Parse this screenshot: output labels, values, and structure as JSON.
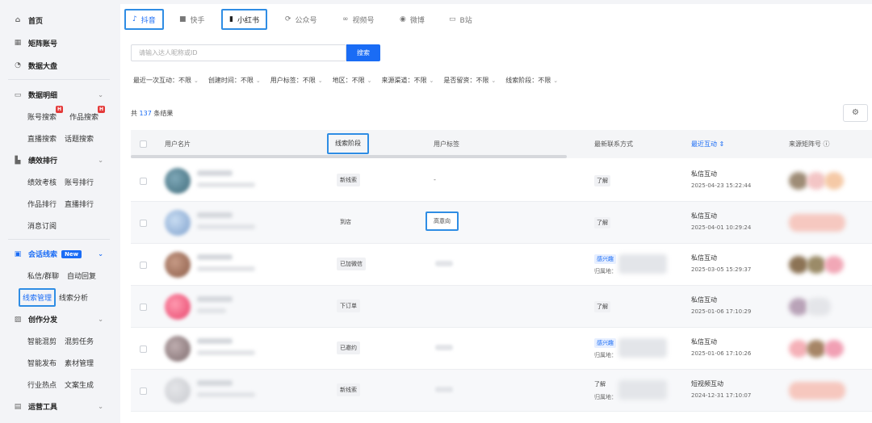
{
  "sidebar": {
    "top_items": [
      {
        "label": "首页",
        "icon": "home-icon"
      },
      {
        "label": "矩阵账号",
        "icon": "grid-icon"
      },
      {
        "label": "数据大盘",
        "icon": "pie-icon"
      }
    ],
    "groups": {
      "data_detail": {
        "label": "数据明细",
        "subs": [
          "账号搜索",
          "作品搜索",
          "直播搜索",
          "话题搜索"
        ],
        "hot_badge": "H"
      },
      "performance": {
        "label": "绩效排行",
        "subs": [
          "绩效考核",
          "账号排行",
          "作品排行",
          "直播排行",
          "消息订阅"
        ]
      },
      "leads": {
        "label": "会话线索",
        "badge": "New",
        "subs": [
          "私信/群聊",
          "自动回复",
          "线索管理",
          "线索分析"
        ]
      },
      "create": {
        "label": "创作分发",
        "subs": [
          "智能混剪",
          "混剪任务",
          "智能发布",
          "素材管理",
          "行业热点",
          "文案生成"
        ]
      },
      "ops": {
        "label": "运营工具"
      }
    }
  },
  "tabs": [
    {
      "label": "抖音",
      "icon": "douyin-icon"
    },
    {
      "label": "快手",
      "icon": "kuaishou-icon"
    },
    {
      "label": "小红书",
      "icon": "xiaohongshu-icon"
    },
    {
      "label": "公众号",
      "icon": "wechat-official-icon"
    },
    {
      "label": "视频号",
      "icon": "channels-icon"
    },
    {
      "label": "微博",
      "icon": "weibo-icon"
    },
    {
      "label": "B站",
      "icon": "bilibili-icon"
    }
  ],
  "search": {
    "placeholder": "请输入达人昵称或ID",
    "button": "搜索"
  },
  "filters": [
    {
      "name": "最近一次互动：",
      "value": "不限"
    },
    {
      "name": "创建时间：",
      "value": "不限"
    },
    {
      "name": "用户标签：",
      "value": "不限"
    },
    {
      "name": "地区：",
      "value": "不限"
    },
    {
      "name": "来源渠道：",
      "value": "不限"
    },
    {
      "name": "是否留资：",
      "value": "不限"
    },
    {
      "name": "线索阶段：",
      "value": "不限"
    }
  ],
  "results": {
    "prefix": "共",
    "count": "137",
    "suffix": "条结果"
  },
  "table": {
    "headers": {
      "card": "用户名片",
      "stage": "线索阶段",
      "tag": "用户标签",
      "contact": "最新联系方式",
      "interaction": "最近互动 ⇕",
      "source": "来源矩阵号 ⓘ"
    },
    "rows": [
      {
        "stage": "新线索",
        "tag": "-",
        "contact": "了解",
        "itype": "私信互动",
        "itime": "2025-04-23 15:22:44"
      },
      {
        "stage": "到店",
        "tag": "高意向",
        "contact": "了解",
        "itype": "私信互动",
        "itime": "2025-04-01 10:29:24"
      },
      {
        "stage": "已加微信",
        "contact_blue": "感兴趣",
        "loc": "归属地：",
        "itype": "私信互动",
        "itime": "2025-03-05 15:29:37"
      },
      {
        "stage": "下订单",
        "contact": "了解",
        "itype": "私信互动",
        "itime": "2025-01-06 17:10:29"
      },
      {
        "stage": "已邀约",
        "contact_blue": "感兴趣",
        "loc": "归属地：",
        "itype": "私信互动",
        "itime": "2025-01-06 17:10:26"
      },
      {
        "stage": "新线索",
        "contact": "了解",
        "loc": "归属地：",
        "itype": "短视频互动",
        "itime": "2024-12-31 17:10:07"
      }
    ]
  },
  "colors": {
    "accent": "#1a6cf5",
    "highlight_box": "#2f8de4",
    "hot": "#e43a3a"
  }
}
